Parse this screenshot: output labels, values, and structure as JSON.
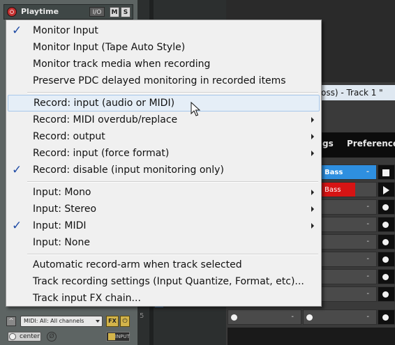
{
  "track": {
    "name": "Playtime",
    "io_label": "I/O",
    "mute_label": "M",
    "solo_label": "S",
    "midi_channel": "MIDI: All: All channels",
    "fx_label": "FX",
    "fx_power": "⏻",
    "env_icon": "^",
    "pan_value": "center",
    "phase_symbol": "Ø",
    "input_label": "INPUT"
  },
  "arrange": {
    "row_number": "5"
  },
  "midi_editor": {
    "title": "oss) - Track 1 \"",
    "menu_settings": "gs",
    "menu_preferences": "Preferences",
    "slots": [
      {
        "label": "Bass",
        "dash": "-",
        "style": "blue"
      },
      {
        "label": "Bass",
        "dash": "",
        "style": "red"
      },
      {
        "label": "",
        "dash": "-",
        "style": "empty"
      },
      {
        "label": "",
        "dash": "-",
        "style": "empty"
      },
      {
        "label": "",
        "dash": "-",
        "style": "empty"
      },
      {
        "label": "",
        "dash": "-",
        "style": "empty"
      },
      {
        "label": "",
        "dash": "-",
        "style": "empty"
      },
      {
        "label": "",
        "dash": "-",
        "style": "empty"
      },
      {
        "label": "",
        "dash": "-",
        "style": "empty"
      },
      {
        "label": "",
        "dash": "-",
        "style": "empty"
      }
    ],
    "bottom_slot_left_dash": "-",
    "bottom_slot_right_dash": "-"
  },
  "context_menu": {
    "items": [
      {
        "label": "Monitor Input",
        "checked": true,
        "submenu": false
      },
      {
        "label": "Monitor Input (Tape Auto Style)",
        "checked": false,
        "submenu": false
      },
      {
        "label": "Monitor track media when recording",
        "checked": false,
        "submenu": false
      },
      {
        "label": "Preserve PDC delayed monitoring in recorded items",
        "checked": false,
        "submenu": false
      },
      {
        "label": "Record: input (audio or MIDI)",
        "checked": false,
        "submenu": false,
        "highlighted": true
      },
      {
        "label": "Record: MIDI overdub/replace",
        "checked": false,
        "submenu": true
      },
      {
        "label": "Record: output",
        "checked": false,
        "submenu": true
      },
      {
        "label": "Record: input (force format)",
        "checked": false,
        "submenu": true
      },
      {
        "label": "Record: disable (input monitoring only)",
        "checked": true,
        "submenu": false
      },
      {
        "label": "Input: Mono",
        "checked": false,
        "submenu": true
      },
      {
        "label": "Input: Stereo",
        "checked": false,
        "submenu": true
      },
      {
        "label": "Input: MIDI",
        "checked": true,
        "submenu": true
      },
      {
        "label": "Input: None",
        "checked": false,
        "submenu": false
      },
      {
        "label": "Automatic record-arm when track selected",
        "checked": false,
        "submenu": false
      },
      {
        "label": "Track recording settings (Input Quantize, Format, etc)...",
        "checked": false,
        "submenu": false
      },
      {
        "label": "Track input FX chain...",
        "checked": false,
        "submenu": false
      }
    ],
    "check_glyph": "✓"
  }
}
